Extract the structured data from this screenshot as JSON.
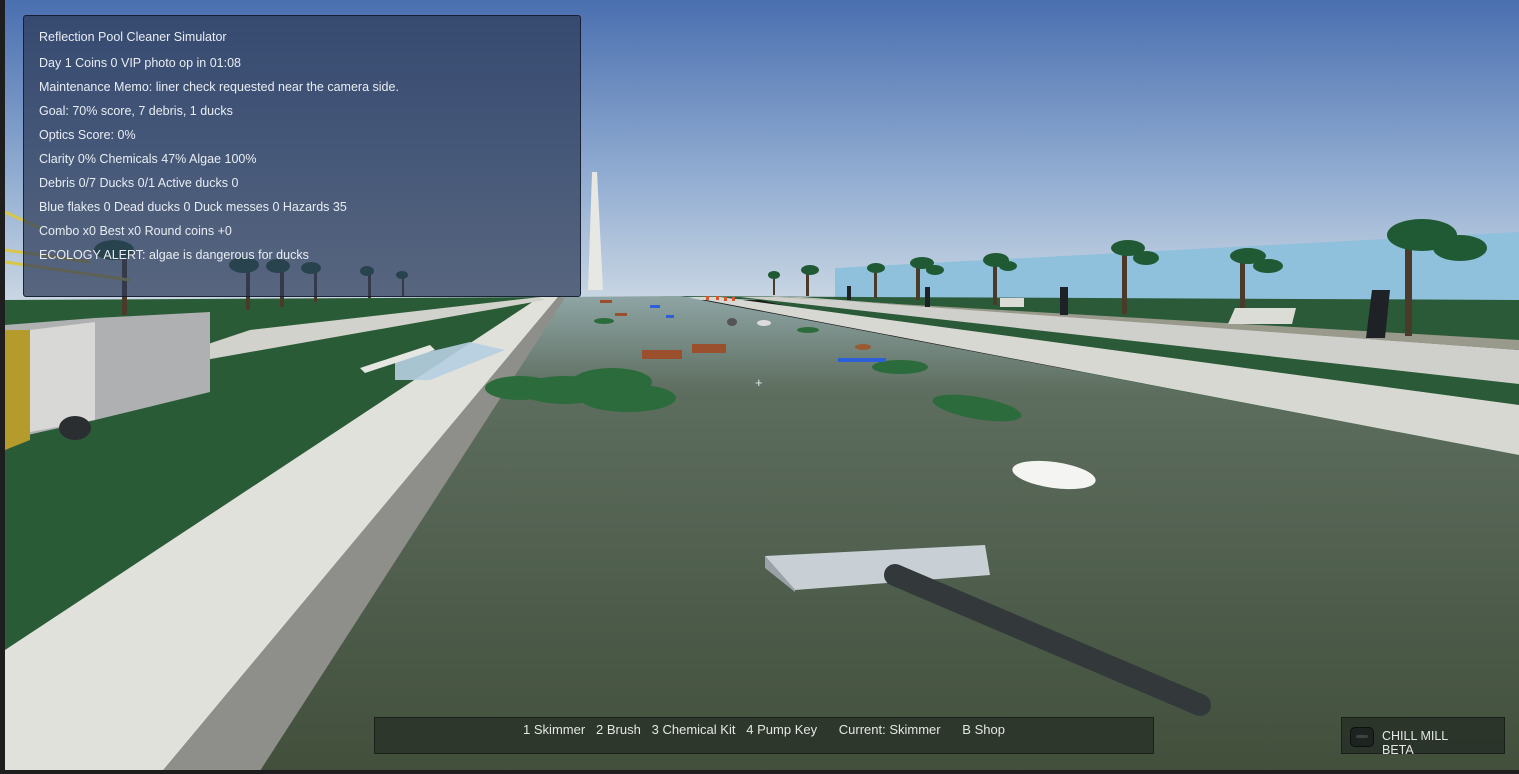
{
  "hud": {
    "title": "Reflection Pool Cleaner Simulator",
    "status": "Day 1  Coins 0  VIP photo op in 01:08",
    "memo": "Maintenance Memo: liner check requested near the camera side.",
    "goal": "Goal: 70% score, 7 debris, 1 ducks",
    "optics": "Optics Score: 0%",
    "water": "Clarity 0%  Chemicals 47%  Algae 100%",
    "counts": "Debris 0/7  Ducks 0/1  Active ducks 0",
    "hazards": "Blue flakes 0  Dead ducks 0  Duck messes 0  Hazards 35",
    "combo": "Combo x0  Best x0  Round coins +0",
    "alert": "ECOLOGY ALERT: algae is dangerous for ducks"
  },
  "toolbar": {
    "text": "1 Skimmer   2 Brush   3 Chemical Kit   4 Pump Key      Current: Skimmer      B Shop"
  },
  "badge": {
    "line1": "CHILL MILL",
    "line2": "BETA"
  },
  "crosshair": "+",
  "colors": {
    "sky_top": "#4a6fb0",
    "sky_bottom": "#c9d6e3",
    "water": "#45523f",
    "grass": "#2a5a37",
    "walkway": "#d9d9d4",
    "hud_bg": "#2d3a58"
  }
}
